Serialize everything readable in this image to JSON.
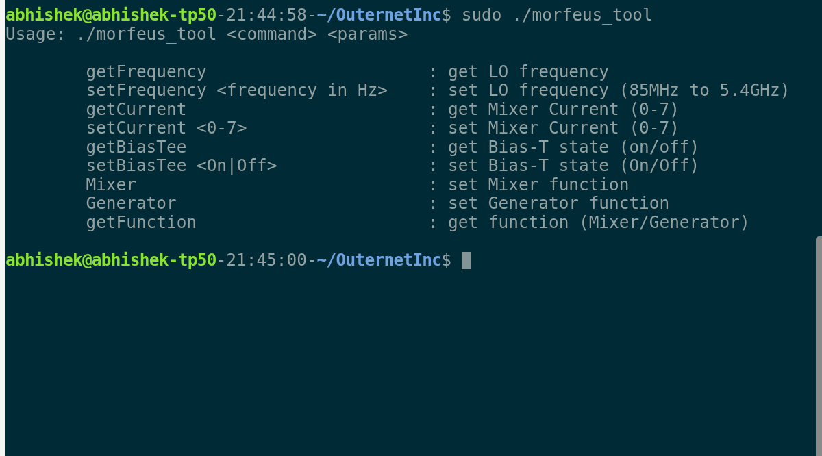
{
  "terminal": {
    "lines": [
      {
        "kind": "prompt",
        "user_host": "abhishek@abhishek-tp50",
        "time": "-21:44:58-",
        "path": "~/OuternetInc",
        "symbol": "$",
        "command": "sudo ./morfeus_tool",
        "cursor": false
      },
      {
        "kind": "output",
        "text": "Usage: ./morfeus_tool <command> <params>"
      },
      {
        "kind": "blank"
      },
      {
        "kind": "usage_row",
        "command": "getFrequency",
        "description": ": get LO frequency"
      },
      {
        "kind": "usage_row",
        "command": "setFrequency <frequency in Hz>",
        "description": ": set LO frequency (85MHz to 5.4GHz)"
      },
      {
        "kind": "usage_row",
        "command": "getCurrent",
        "description": ": get Mixer Current (0-7)"
      },
      {
        "kind": "usage_row",
        "command": "setCurrent <0-7>",
        "description": ": set Mixer Current (0-7)"
      },
      {
        "kind": "usage_row",
        "command": "getBiasTee",
        "description": ": get Bias-T state (on/off)"
      },
      {
        "kind": "usage_row",
        "command": "setBiasTee <On|Off>",
        "description": ": set Bias-T state (On/Off)"
      },
      {
        "kind": "usage_row",
        "command": "Mixer",
        "description": ": set Mixer function"
      },
      {
        "kind": "usage_row",
        "command": "Generator",
        "description": ": set Generator function"
      },
      {
        "kind": "usage_row",
        "command": "getFunction",
        "description": ": get function (Mixer/Generator)"
      },
      {
        "kind": "blank"
      },
      {
        "kind": "prompt",
        "user_host": "abhishek@abhishek-tp50",
        "time": "-21:45:00-",
        "path": "~/OuternetInc",
        "symbol": "$",
        "cursor": true
      }
    ]
  }
}
